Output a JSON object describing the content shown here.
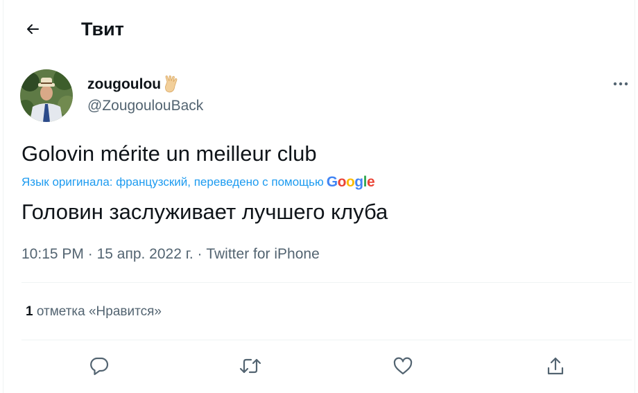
{
  "header": {
    "title": "Твит",
    "back_icon": "arrow-left-icon"
  },
  "author": {
    "name": "zougoulou",
    "name_emoji": "vulcan-salute-emoji",
    "handle": "@ZougoulouBack"
  },
  "tweet": {
    "text": "Golovin mérite un meilleur club",
    "translation_label": "Язык оригинала: французский, переведено с помощью",
    "translation_provider": "Google",
    "translated_text": "Головин заслуживает лучшего клуба",
    "time": "10:15 PM",
    "date": "15 апр. 2022 г.",
    "separator": "·",
    "source": "Twitter for iPhone"
  },
  "stats": {
    "likes_count": "1",
    "likes_label": "отметка «Нравится»"
  },
  "actions": {
    "reply_icon": "reply-icon",
    "retweet_icon": "retweet-icon",
    "like_icon": "heart-icon",
    "share_icon": "share-icon"
  },
  "colors": {
    "text": "#0f1419",
    "secondary": "#536471",
    "accent": "#1d9bf0",
    "divider": "#eff3f4"
  }
}
